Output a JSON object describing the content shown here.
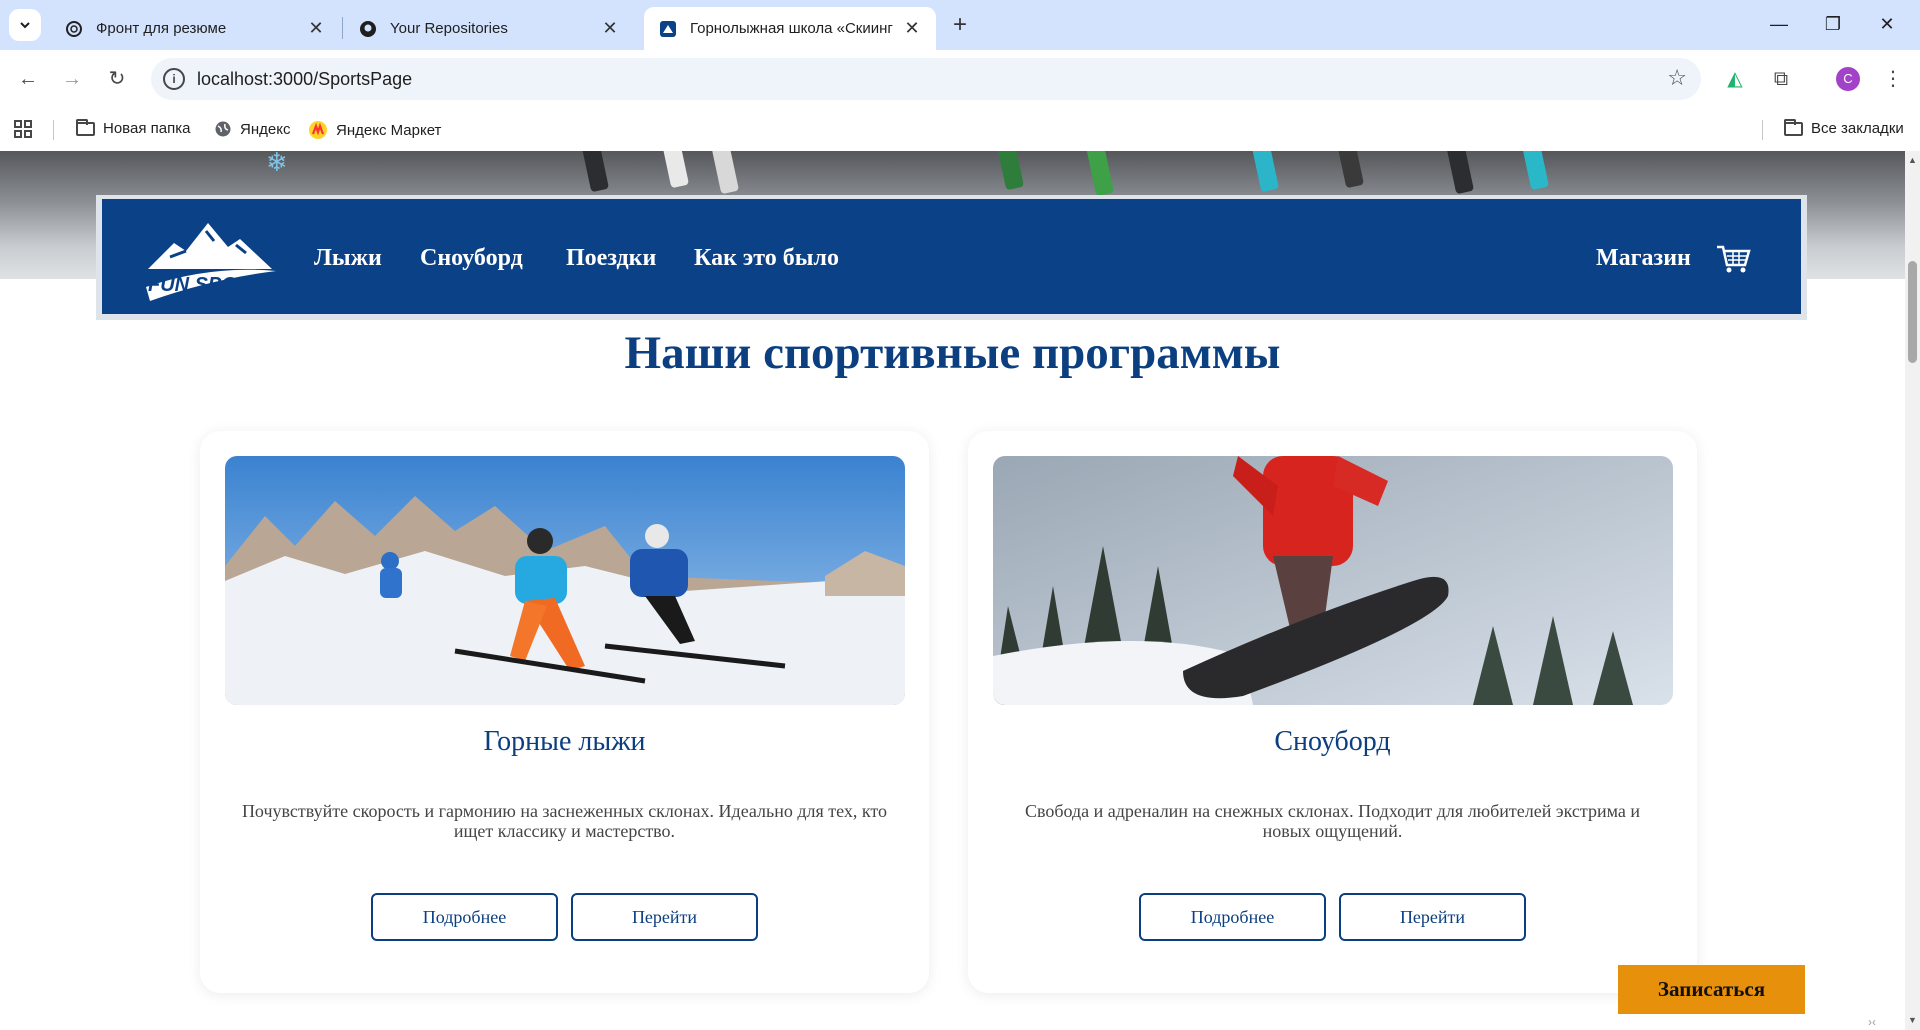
{
  "browser": {
    "tabs": [
      {
        "title": "Фронт для резюме",
        "icon": "chatgpt-icon",
        "active": false
      },
      {
        "title": "Your Repositories",
        "icon": "github-icon",
        "active": false
      },
      {
        "title": "Горнолыжная школа «Скиинг",
        "icon": "site-icon",
        "active": true
      }
    ],
    "new_tab_label": "+",
    "url": "localhost:3000/SportsPage",
    "profile_initial": "C",
    "bookmarks": [
      {
        "label": "Новая папка",
        "icon": "folder-icon"
      },
      {
        "label": "Яндекс",
        "icon": "globe-icon"
      },
      {
        "label": "Яндекс Маркет",
        "icon": "yandex-market-icon"
      }
    ],
    "all_bookmarks_label": "Все закладки"
  },
  "site": {
    "logo_text": "FUN SPORT",
    "nav": [
      "Лыжи",
      "Сноуборд",
      "Поездки",
      "Как это было"
    ],
    "shop_label": "Магазин",
    "page_title": "Наши спортивные программы",
    "cards": [
      {
        "title": "Горные лыжи",
        "description": "Почувствуйте скорость и гармонию на заснеженных склонах. Идеально для тех, кто ищет классику и мастерство.",
        "more_label": "Подробнее",
        "go_label": "Перейти"
      },
      {
        "title": "Сноуборд",
        "description": "Свобода и адреналин на снежных склонах. Подходит для любителей экстрима и новых ощущений.",
        "more_label": "Подробнее",
        "go_label": "Перейти"
      }
    ],
    "signup_label": "Записаться"
  },
  "colors": {
    "tabstrip": "#d3e3fd",
    "navbar": "#0b4187",
    "title": "#0b3f80",
    "signup": "#e6900b"
  }
}
